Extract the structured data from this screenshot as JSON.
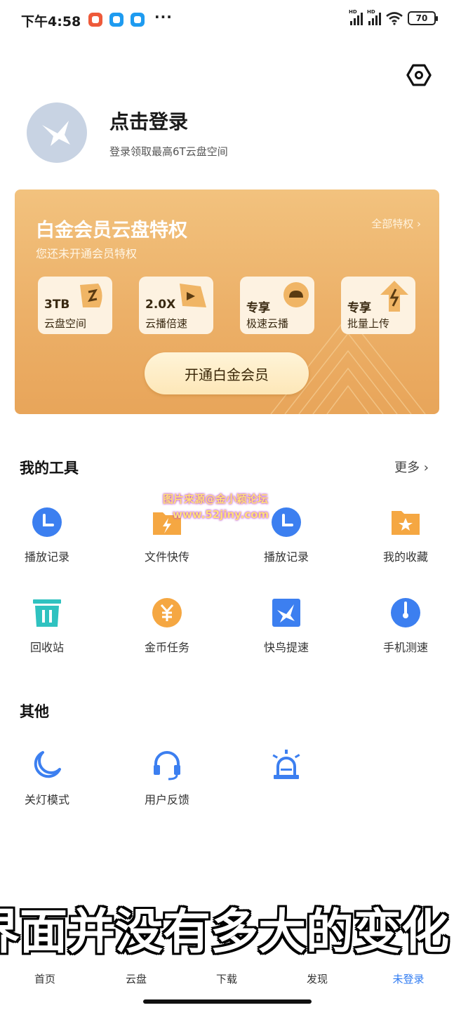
{
  "status_bar": {
    "time": "下午4:58",
    "dots": "···",
    "battery": "70",
    "hd": "HD"
  },
  "profile": {
    "title": "点击登录",
    "subtitle": "登录领取最高6T云盘空间"
  },
  "vip": {
    "title": "白金会员云盘特权",
    "subtitle": "您还未开通会员特权",
    "all_perks": "全部特权 ›",
    "perks": [
      {
        "line1": "3TB",
        "line2": "云盘空间"
      },
      {
        "line1": "2.0X",
        "line2": "云播倍速"
      },
      {
        "line1": "专享",
        "line2": "极速云播"
      },
      {
        "line1": "专享",
        "line2": "批量上传"
      }
    ],
    "button": "开通白金会员"
  },
  "tools": {
    "title": "我的工具",
    "more": "更多 ›",
    "items": [
      {
        "label": "播放记录",
        "icon": "clock-icon"
      },
      {
        "label": "文件快传",
        "icon": "lightning-folder-icon"
      },
      {
        "label": "播放记录",
        "icon": "clock-icon"
      },
      {
        "label": "我的收藏",
        "icon": "star-folder-icon"
      },
      {
        "label": "回收站",
        "icon": "trash-icon"
      },
      {
        "label": "金币任务",
        "icon": "coin-icon"
      },
      {
        "label": "快鸟提速",
        "icon": "bird-icon"
      },
      {
        "label": "手机测速",
        "icon": "speedometer-icon"
      }
    ]
  },
  "other": {
    "title": "其他",
    "items": [
      {
        "label": "关灯模式",
        "icon": "moon-icon"
      },
      {
        "label": "用户反馈",
        "icon": "headset-icon"
      },
      {
        "label": "",
        "icon": "alarm-light-icon"
      }
    ]
  },
  "watermark": {
    "line1": "图片来源@金小颖论坛",
    "line2": "www.52jiny.com"
  },
  "caption": "界面并没有多大的变化",
  "nav": [
    {
      "label": "首页"
    },
    {
      "label": "云盘"
    },
    {
      "label": "下载"
    },
    {
      "label": "发现"
    },
    {
      "label": "未登录",
      "active": true
    }
  ],
  "colors": {
    "accent": "#2f7bf2",
    "vip_gold": "#ecb068",
    "tool_blue": "#3c7ff0",
    "tool_orange": "#f5a742",
    "tool_teal": "#2fc2c0"
  }
}
